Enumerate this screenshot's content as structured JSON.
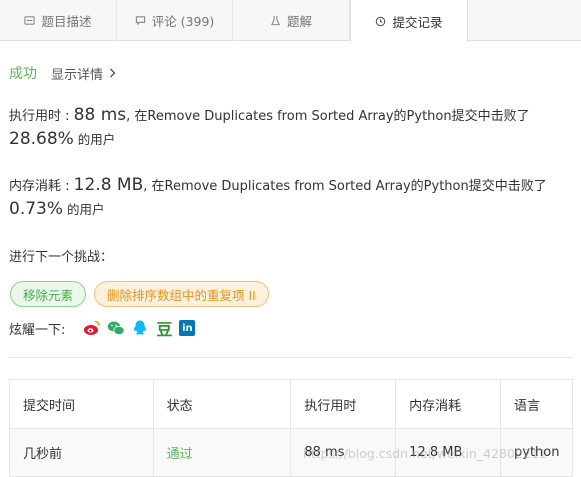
{
  "tabs": [
    {
      "label": "题目描述",
      "icon": "description-icon"
    },
    {
      "label": "评论 (399)",
      "icon": "comment-icon"
    },
    {
      "label": "题解",
      "icon": "flask-icon"
    },
    {
      "label": "提交记录",
      "icon": "clock-icon",
      "active": true
    }
  ],
  "status": {
    "result": "成功",
    "details_link": "显示详情"
  },
  "runtime": {
    "label": "执行用时 : ",
    "value": "88 ms",
    "desc": ", 在Remove Duplicates from Sorted Array的Python提交中击败了",
    "percent": "28.68%",
    "suffix": " 的用户"
  },
  "memory": {
    "label": "内存消耗 : ",
    "value": "12.8 MB",
    "desc": ", 在Remove Duplicates from Sorted Array的Python提交中击败了",
    "percent": "0.73%",
    "suffix": " 的用户"
  },
  "next_challenge": {
    "title": "进行下一个挑战：",
    "chips": [
      "移除元素",
      "删除排序数组中的重复项 II"
    ]
  },
  "share": {
    "label": "炫耀一下:",
    "icons": [
      "weibo-icon",
      "wechat-icon",
      "qq-icon",
      "douban-icon",
      "linkedin-icon"
    ],
    "douban_glyph": "豆",
    "linkedin_glyph": "in"
  },
  "submissions": {
    "headers": [
      "提交时间",
      "状态",
      "执行用时",
      "内存消耗",
      "语言"
    ],
    "rows": [
      {
        "time": "几秒前",
        "status": "通过",
        "runtime": "88 ms",
        "memory": "12.8 MB",
        "language": "python"
      }
    ]
  },
  "watermark": "https://blog.csdn.net/weixin_42802211",
  "colors": {
    "success": "#5cb85c",
    "chip_orange": "#e6951f",
    "weibo": "#e6162d",
    "wechat": "#2aae67",
    "qq": "#12b7f5",
    "douban": "#2c962c",
    "linkedin": "#0077b5"
  }
}
